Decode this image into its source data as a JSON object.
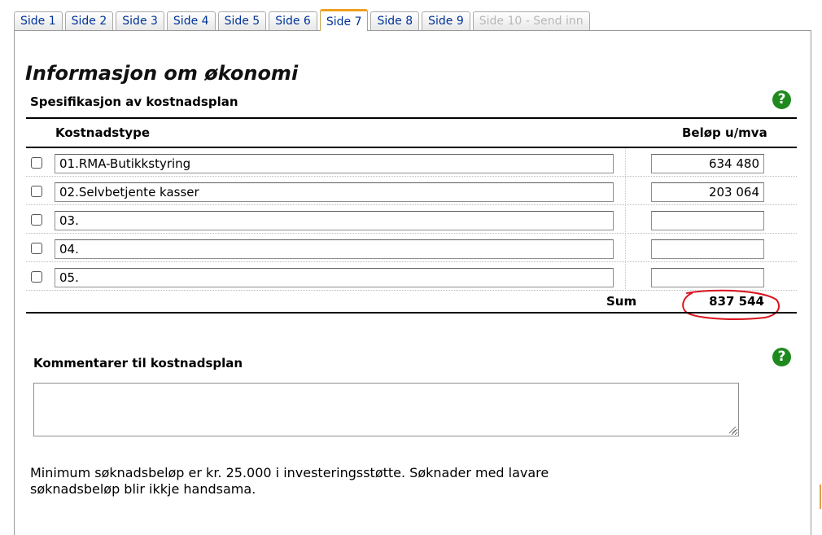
{
  "tabs": [
    {
      "label": "Side 1",
      "state": "normal"
    },
    {
      "label": "Side 2",
      "state": "normal"
    },
    {
      "label": "Side 3",
      "state": "normal"
    },
    {
      "label": "Side 4",
      "state": "normal"
    },
    {
      "label": "Side 5",
      "state": "normal"
    },
    {
      "label": "Side 6",
      "state": "normal"
    },
    {
      "label": "Side 7",
      "state": "active"
    },
    {
      "label": "Side 8",
      "state": "normal"
    },
    {
      "label": "Side 9",
      "state": "normal"
    },
    {
      "label": "Side 10 - Send inn",
      "state": "disabled"
    }
  ],
  "page": {
    "title": "Informasjon om økonomi",
    "section_title": "Spesifikasjon av kostnadsplan",
    "help_glyph": "?"
  },
  "table": {
    "col_type": "Kostnadstype",
    "col_amount": "Beløp u/mva",
    "rows": [
      {
        "type": "01.RMA-Butikkstyring",
        "amount": "634 480",
        "checked": false
      },
      {
        "type": "02.Selvbetjente kasser",
        "amount": "203 064",
        "checked": false
      },
      {
        "type": "03.",
        "amount": "",
        "checked": false
      },
      {
        "type": "04.",
        "amount": "",
        "checked": false
      },
      {
        "type": "05.",
        "amount": "",
        "checked": false
      }
    ],
    "sum_label": "Sum",
    "sum_value": "837 544"
  },
  "comments": {
    "title": "Kommentarer til kostnadsplan",
    "value": ""
  },
  "info_text": "Minimum søknadsbeløp er kr. 25.000 i investeringsstøtte. Søknader med lavare søknadsbeløp blir ikkje handsama.",
  "colors": {
    "help_green": "#1e8a1e",
    "annotation_red": "#d9141e",
    "active_tab_accent": "#f0a020",
    "tab_text": "#003399"
  },
  "icons": {
    "help": "question-circle-icon",
    "annotation": "hand-drawn-circle-annotation"
  }
}
